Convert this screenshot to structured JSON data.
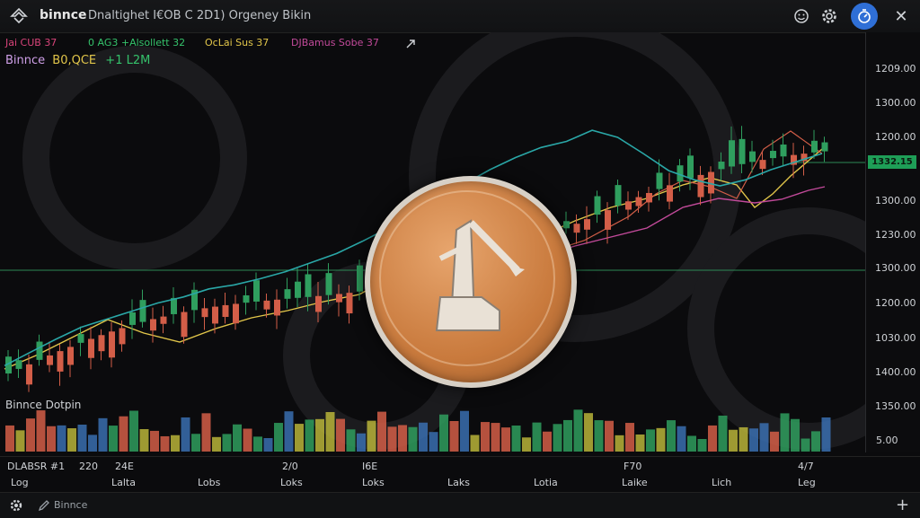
{
  "app": {
    "name": "binnce",
    "title": "Dnaltighet I€OB C 2D1) Orgeney Bikin"
  },
  "indicators": [
    {
      "label": "Jai CUB 37",
      "color": "#d9447a"
    },
    {
      "label": "0 AG3 +Alsollett 32",
      "color": "#35c26b"
    },
    {
      "label": "OcLai Sus 37",
      "color": "#e2c64a"
    },
    {
      "label": "DJBamus Sobe 37",
      "color": "#c24a9a"
    }
  ],
  "ticker": {
    "name": "Binnce",
    "pair": "B0,QCE",
    "change": "+1 L2M"
  },
  "price_axis": {
    "labels": [
      "1209.00",
      "1300.00",
      "1200.00",
      "1300.00",
      "1230.00",
      "1300.00",
      "1200.00",
      "1030.00",
      "1400.00",
      "1350.00"
    ],
    "current": "1332.15"
  },
  "volume": {
    "label": "Binnce Dotpin",
    "axis_label": "5.00"
  },
  "time_axis": {
    "top": [
      "DLABSR #1",
      "220",
      "24E",
      "2/0",
      "I6E",
      "F70",
      "4/7"
    ],
    "bottom": [
      "Log",
      "Lalta",
      "Lobs",
      "Loks",
      "Loks",
      "Laks",
      "Lotia",
      "Laike",
      "Lich",
      "Leg"
    ]
  },
  "footer": {
    "label": "Binnce"
  },
  "colors": {
    "up": "#2f9e5e",
    "down": "#d35e48",
    "accent": "#2f6fd6",
    "coin": "#c97a3d"
  },
  "icons": [
    "binance-logo-icon",
    "emoji-icon",
    "settings-gear-icon",
    "timer-icon",
    "close-icon",
    "cursor-icon",
    "gear-icon",
    "pencil-icon",
    "plus-icon"
  ],
  "chart_data": {
    "type": "line",
    "series": [
      {
        "values": [
          1398,
          1385,
          1372,
          1360,
          1352,
          1344,
          1336,
          1330,
          1322,
          1318,
          1312,
          1305,
          1296,
          1287,
          1275,
          1262,
          1248,
          1232,
          1218,
          1204,
          1192,
          1182,
          1176,
          1165,
          1172,
          1188,
          1205,
          1214,
          1220,
          1214,
          1204,
          1196,
          1188
        ]
      }
    ],
    "grid": false,
    "legend": "top-left"
  }
}
